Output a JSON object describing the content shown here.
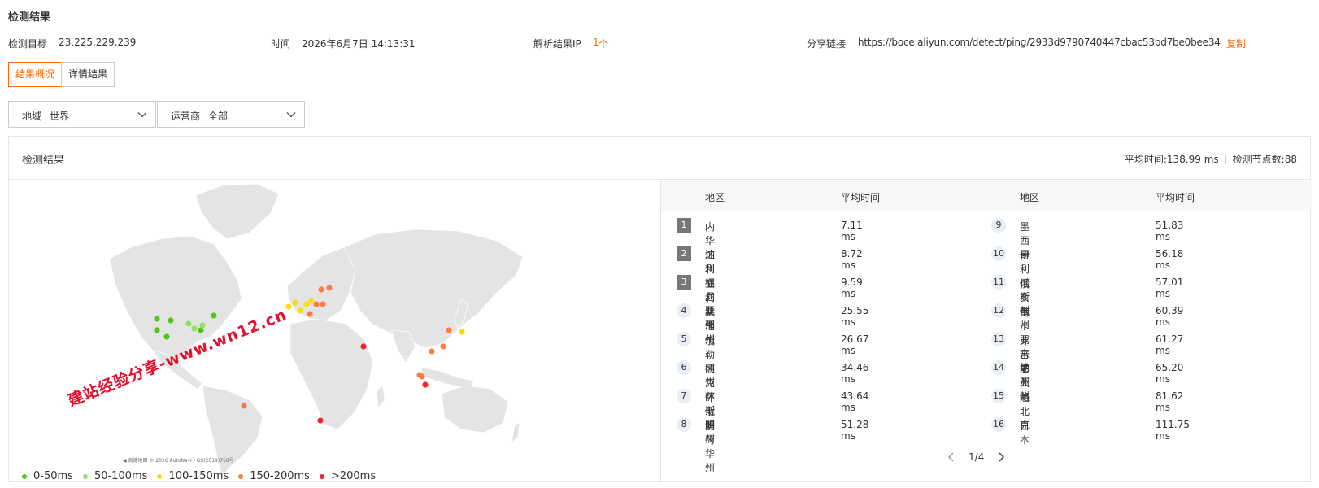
{
  "page_title": "检测结果",
  "info": {
    "target_label": "检测目标",
    "target_value": "23.225.229.239",
    "time_label": "时间",
    "time_value": "2026年6月7日 14:13:31",
    "resolve_label": "解析结果IP",
    "resolve_count": "1",
    "resolve_unit": "个",
    "share_label": "分享链接",
    "share_url": "https://boce.aliyun.com/detect/ping/2933d9790740447cbac53bd7be0bee34",
    "copy_label": "复制"
  },
  "tabs": [
    {
      "label": "结果概况",
      "active": true
    },
    {
      "label": "详情结果",
      "active": false
    }
  ],
  "filters": {
    "region_label": "地域",
    "region_value": "世界",
    "isp_label": "运营商",
    "isp_value": "全部"
  },
  "card": {
    "title": "检测结果",
    "avg_time": "平均时间:138.99 ms",
    "node_count": "检测节点数:88"
  },
  "map": {
    "watermark": "建站经验分享-www.wn12.cn",
    "credit": "◀ 高德地图 © 2026 AutoNavi - GS(2019)758号",
    "legend": [
      {
        "label": "0-50ms",
        "color": "#52c41a"
      },
      {
        "label": "50-100ms",
        "color": "#95de64"
      },
      {
        "label": "100-150ms",
        "color": "#fadb14"
      },
      {
        "label": "150-200ms",
        "color": "#ff7a45"
      },
      {
        "label": ">200ms",
        "color": "#f5222d"
      }
    ]
  },
  "table": {
    "headers": {
      "region": "地区",
      "avg": "平均时间"
    },
    "left_rows": [
      {
        "rank": "1",
        "region": "内华达州",
        "avg": "7.11 ms"
      },
      {
        "rank": "2",
        "region": "加利福尼亚州",
        "avg": "8.72 ms"
      },
      {
        "rank": "3",
        "region": "亚利桑那州",
        "avg": "9.59 ms"
      },
      {
        "rank": "4",
        "region": "犹他州",
        "avg": "25.55 ms"
      },
      {
        "rank": "5",
        "region": "俄勒冈州",
        "avg": "26.67 ms"
      },
      {
        "rank": "6",
        "region": "德克萨斯州",
        "avg": "34.46 ms"
      },
      {
        "rank": "7",
        "region": "怀俄明州",
        "avg": "43.64 ms"
      },
      {
        "rank": "8",
        "region": "爱荷华州",
        "avg": "51.28 ms"
      }
    ],
    "right_rows": [
      {
        "rank": "9",
        "region": "墨西哥",
        "avg": "51.83 ms"
      },
      {
        "rank": "10",
        "region": "伊利诺斯州",
        "avg": "56.18 ms"
      },
      {
        "rank": "11",
        "region": "俄亥俄州",
        "avg": "57.01 ms"
      },
      {
        "rank": "12",
        "region": "南卡罗来纳州",
        "avg": "60.39 ms"
      },
      {
        "rank": "13",
        "region": "弗吉尼亚州",
        "avg": "61.27 ms"
      },
      {
        "rank": "14",
        "region": "安大略",
        "avg": "65.20 ms"
      },
      {
        "rank": "15",
        "region": "魁北克",
        "avg": "81.62 ms"
      },
      {
        "rank": "16",
        "region": "日本",
        "avg": "111.75 ms"
      }
    ],
    "pager": "1/4"
  }
}
